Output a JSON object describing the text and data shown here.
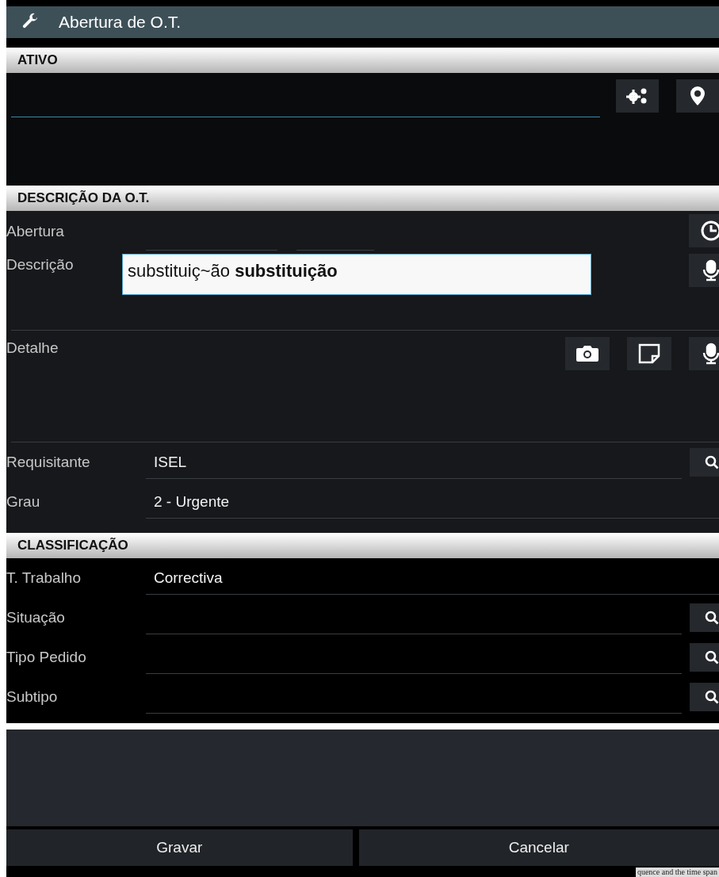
{
  "window": {
    "title": "Abertura de O.T."
  },
  "ativo": {
    "header": "ATIVO"
  },
  "descricao": {
    "header": "DESCRIÇÃO DA O.T.",
    "abertura_label": "Abertura",
    "descricao_label": "Descrição",
    "descricao_value": "substituiç~ão **substituição**",
    "detalhe_label": "Detalhe",
    "rows": [
      {
        "label": "Requisitante",
        "value": "ISEL",
        "search": true
      },
      {
        "label": "Grau",
        "value": "2 - Urgente",
        "search": false
      }
    ]
  },
  "classificacao": {
    "header": "CLASSIFICAÇÃO",
    "rows": [
      {
        "label": "T. Trabalho",
        "value": "Correctiva",
        "search": false
      },
      {
        "label": "Situação",
        "value": "",
        "search": true
      },
      {
        "label": "Tipo Pedido",
        "value": "",
        "search": true
      },
      {
        "label": "Subtipo",
        "value": "",
        "search": true
      }
    ]
  },
  "buttons": [
    "Gravar",
    "Cancelar"
  ],
  "background_text": "quence and the time span"
}
